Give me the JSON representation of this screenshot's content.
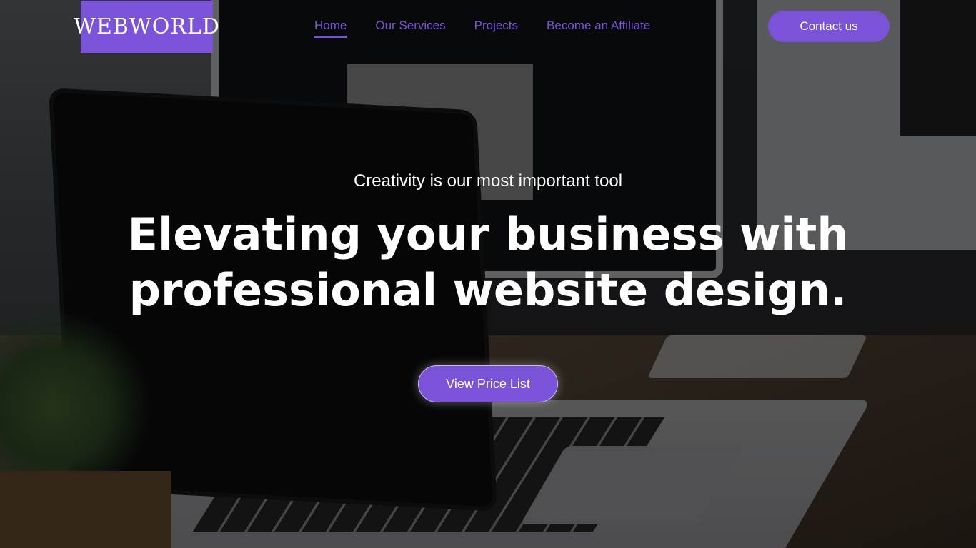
{
  "logo": {
    "text": "WEBWORLD"
  },
  "nav": {
    "items": [
      {
        "label": "Home",
        "active": true
      },
      {
        "label": "Our Services",
        "active": false
      },
      {
        "label": "Projects",
        "active": false
      },
      {
        "label": "Become an Affiliate",
        "active": false
      }
    ]
  },
  "header": {
    "contact_label": "Contact us"
  },
  "hero": {
    "tagline": "Creativity is our most important tool",
    "headline_line1": "Elevating your business with",
    "headline_line2": "professional website design.",
    "cta_label": "View Price List"
  },
  "colors": {
    "accent": "#7b53d9",
    "text": "#ffffff"
  }
}
